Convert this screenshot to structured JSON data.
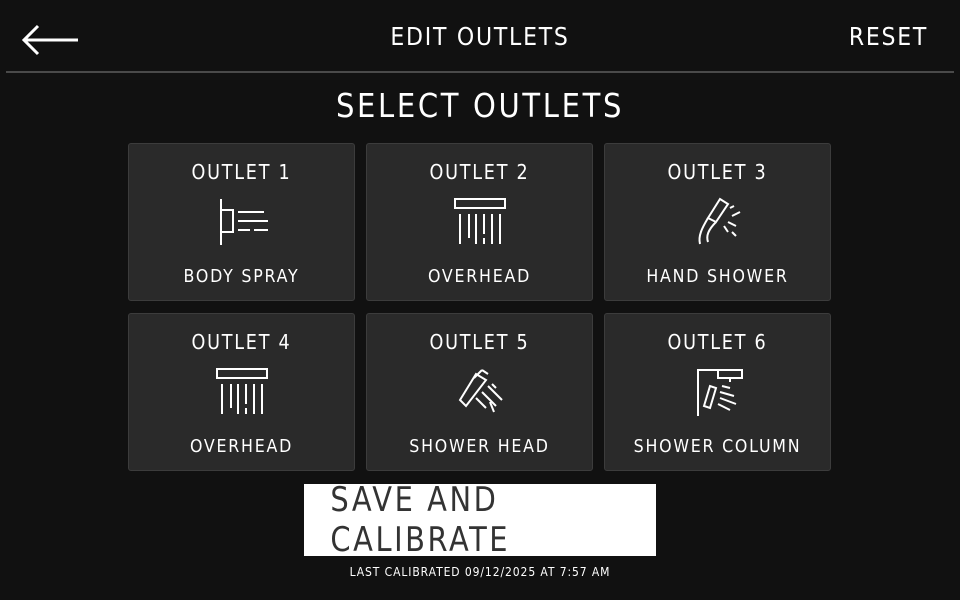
{
  "header": {
    "title": "EDIT OUTLETS",
    "back_icon": "arrow-left-icon",
    "reset_label": "RESET"
  },
  "section_title": "SELECT OUTLETS",
  "outlets": [
    {
      "number_label": "OUTLET 1",
      "type_label": "BODY SPRAY",
      "icon": "body-spray-icon"
    },
    {
      "number_label": "OUTLET 2",
      "type_label": "OVERHEAD",
      "icon": "overhead-icon"
    },
    {
      "number_label": "OUTLET 3",
      "type_label": "HAND SHOWER",
      "icon": "hand-shower-icon"
    },
    {
      "number_label": "OUTLET 4",
      "type_label": "OVERHEAD",
      "icon": "overhead-icon"
    },
    {
      "number_label": "OUTLET 5",
      "type_label": "SHOWER HEAD",
      "icon": "shower-head-icon"
    },
    {
      "number_label": "OUTLET 6",
      "type_label": "SHOWER COLUMN",
      "icon": "shower-column-icon"
    }
  ],
  "save_button_label": "SAVE AND CALIBRATE",
  "last_calibrated": "LAST CALIBRATED 09/12/2025 AT 7:57 AM",
  "colors": {
    "background": "#111111",
    "tile": "#2a2a2a",
    "text": "#ffffff",
    "button_bg": "#ffffff",
    "button_text": "#333333"
  }
}
